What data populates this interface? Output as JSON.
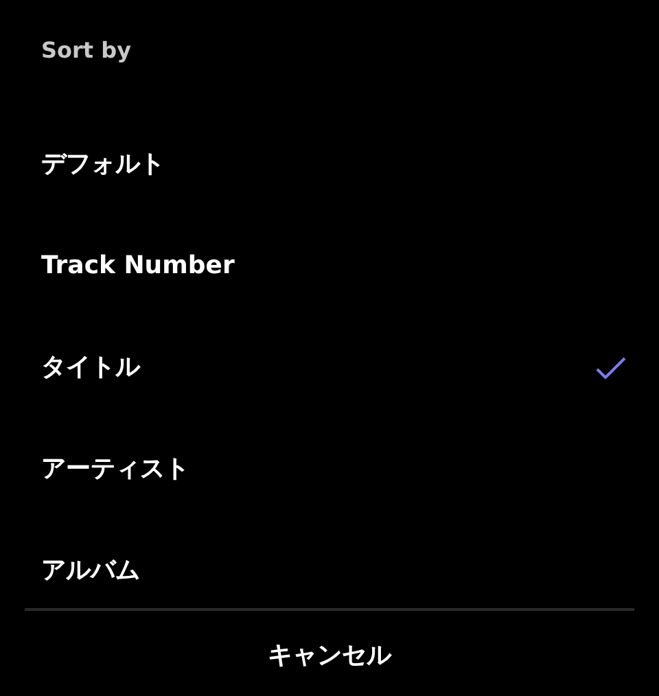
{
  "title": "Sort by",
  "options": [
    {
      "label": "デフォルト",
      "selected": false
    },
    {
      "label": "Track Number",
      "selected": false
    },
    {
      "label": "タイトル",
      "selected": true
    },
    {
      "label": "アーティスト",
      "selected": false
    },
    {
      "label": "アルバム",
      "selected": false
    }
  ],
  "cancel_button": "キャンセル"
}
